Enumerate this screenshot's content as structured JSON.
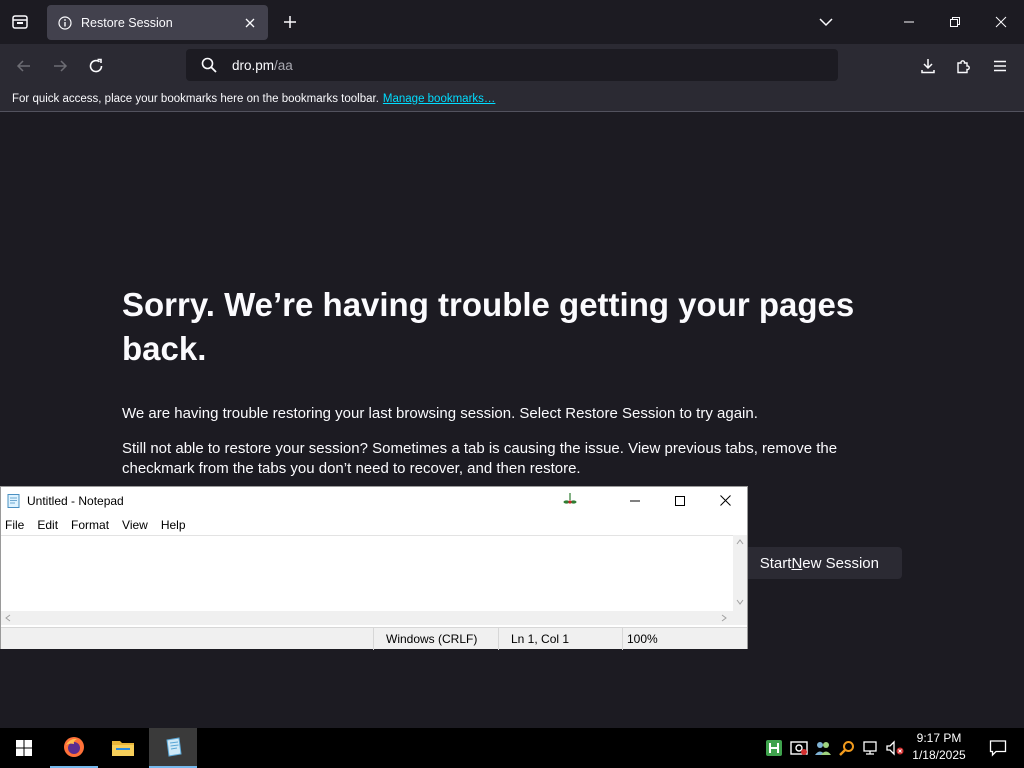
{
  "browser": {
    "tab": {
      "title": "Restore Session",
      "icon": "info-icon"
    },
    "url": {
      "host": "dro.pm",
      "path": "/aa"
    },
    "bookmarks_bar": {
      "text": "For quick access, place your bookmarks here on the bookmarks toolbar.",
      "link": "Manage bookmarks…"
    },
    "accent_color": "#00ddff"
  },
  "page": {
    "title": "Sorry. We’re having trouble getting your pages back.",
    "paragraph1": "We are having trouble restoring your last browsing session. Select Restore Session to try again.",
    "paragraph2": "Still not able to restore your session? Sometimes a tab is causing the issue. View previous tabs, remove the checkmark from the tabs you don’t need to recover, and then restore.",
    "start_new_session": {
      "before": "Start ",
      "accesskey": "N",
      "after": "ew Session"
    }
  },
  "notepad": {
    "title": "Untitled - Notepad",
    "menu": [
      "File",
      "Edit",
      "Format",
      "View",
      "Help"
    ],
    "content": "",
    "status": {
      "encoding": "Windows (CRLF)",
      "position": "Ln 1, Col 1",
      "zoom": "100%"
    }
  },
  "taskbar": {
    "apps": [
      "start-button",
      "firefox",
      "file-explorer",
      "notepad"
    ],
    "clock": {
      "time": "9:17 PM",
      "date": "1/18/2025"
    }
  }
}
